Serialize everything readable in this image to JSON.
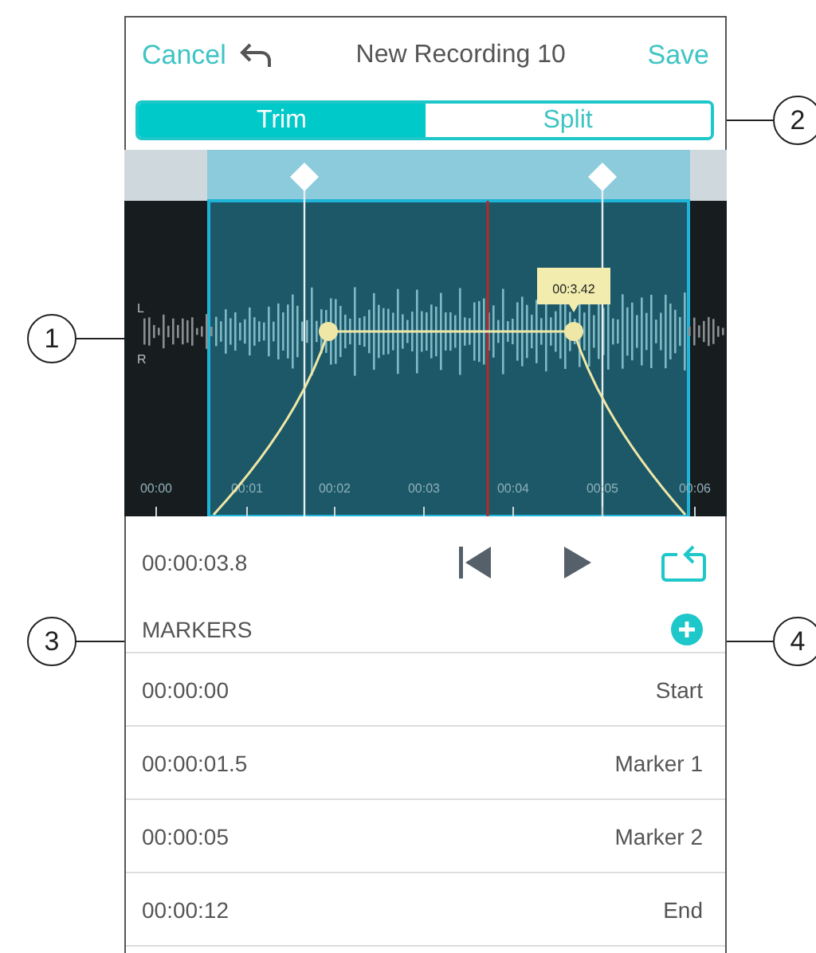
{
  "header": {
    "cancel": "Cancel",
    "title": "New Recording 10",
    "save": "Save"
  },
  "segments": [
    {
      "label": "Trim",
      "selected": true
    },
    {
      "label": "Split",
      "selected": false
    }
  ],
  "waveform": {
    "channels": [
      "L",
      "R"
    ],
    "time_labels": [
      "00:00",
      "00:01",
      "00:02",
      "00:03",
      "00:04",
      "00:05",
      "00:06"
    ],
    "tooltip": "00:3.42"
  },
  "transport": {
    "time": "00:00:03.8"
  },
  "markers": {
    "title": "MARKERS",
    "rows": [
      {
        "time": "00:00:00",
        "name": "Start"
      },
      {
        "time": "00:00:01.5",
        "name": "Marker 1"
      },
      {
        "time": "00:00:05",
        "name": "Marker 2"
      },
      {
        "time": "00:00:12",
        "name": "End"
      }
    ]
  },
  "callouts": [
    "2",
    "1",
    "3",
    "4"
  ]
}
